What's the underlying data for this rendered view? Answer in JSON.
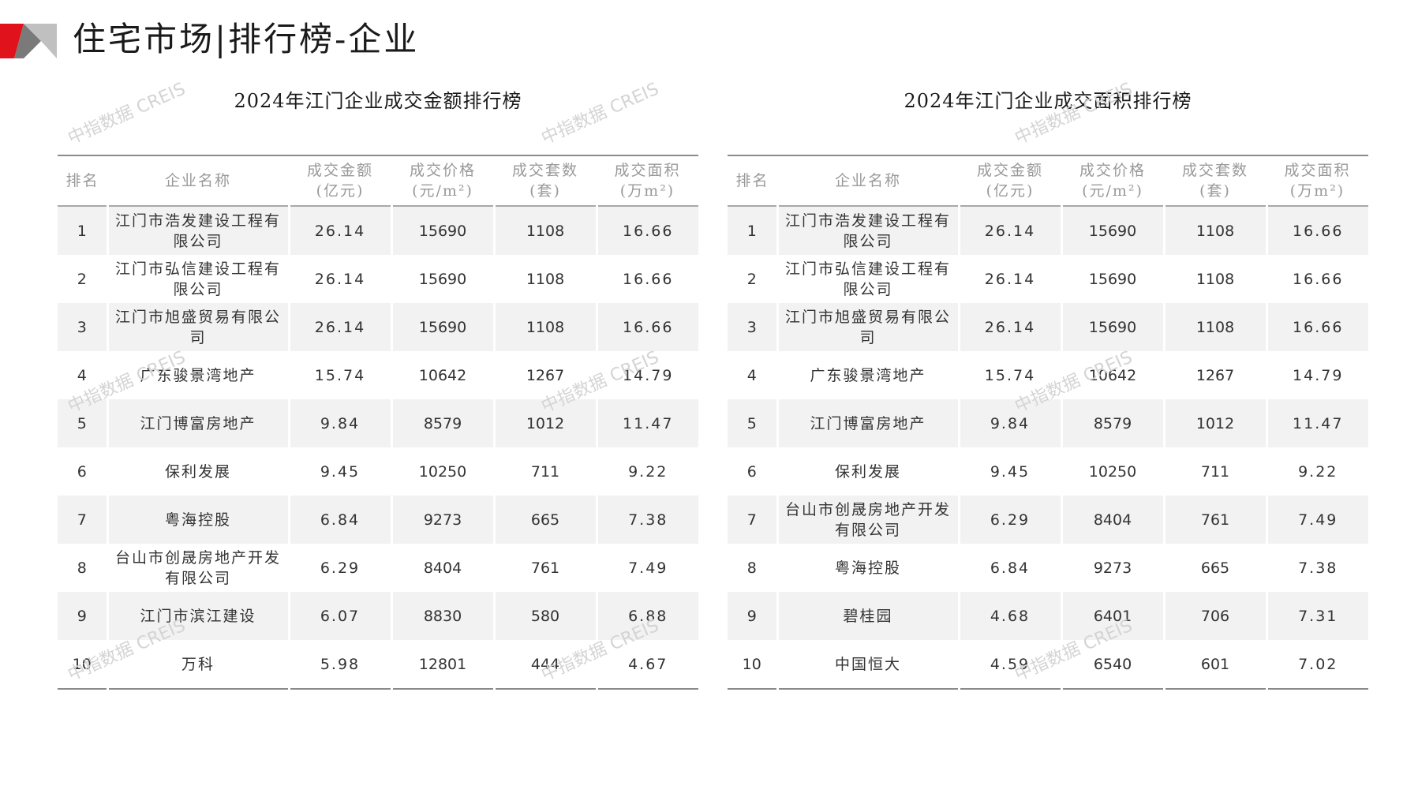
{
  "page": {
    "title": "住宅市场|排行榜-企业",
    "watermark": "中指数据 CREIS",
    "accent_color": "#c8161d",
    "logo_colors": [
      "#e0121b",
      "#7a7a7a",
      "#c0c0c0"
    ]
  },
  "tables": [
    {
      "title": "2024年江门企业成交金额排行榜",
      "highlight_column": "amount",
      "headers": {
        "rank": "排名",
        "company": "企业名称",
        "amount": [
          "成交金额",
          "(亿元)"
        ],
        "price": [
          "成交价格",
          "(元/m²)"
        ],
        "units": [
          "成交套数",
          "(套)"
        ],
        "area": [
          "成交面积",
          "(万m²)"
        ]
      },
      "rows": [
        {
          "rank": "1",
          "company": [
            "江门市浩发建设工程有",
            "限公司"
          ],
          "amount": "26.14",
          "price": "15690",
          "units": "1108",
          "area": "16.66"
        },
        {
          "rank": "2",
          "company": [
            "江门市弘信建设工程有",
            "限公司"
          ],
          "amount": "26.14",
          "price": "15690",
          "units": "1108",
          "area": "16.66"
        },
        {
          "rank": "3",
          "company": [
            "江门市旭盛贸易有限公",
            "司"
          ],
          "amount": "26.14",
          "price": "15690",
          "units": "1108",
          "area": "16.66"
        },
        {
          "rank": "4",
          "company": [
            "广东骏景湾地产"
          ],
          "amount": "15.74",
          "price": "10642",
          "units": "1267",
          "area": "14.79"
        },
        {
          "rank": "5",
          "company": [
            "江门博富房地产"
          ],
          "amount": "9.84",
          "price": "8579",
          "units": "1012",
          "area": "11.47"
        },
        {
          "rank": "6",
          "company": [
            "保利发展"
          ],
          "amount": "9.45",
          "price": "10250",
          "units": "711",
          "area": "9.22"
        },
        {
          "rank": "7",
          "company": [
            "粤海控股"
          ],
          "amount": "6.84",
          "price": "9273",
          "units": "665",
          "area": "7.38"
        },
        {
          "rank": "8",
          "company": [
            "台山市创晟房地产开发",
            "有限公司"
          ],
          "amount": "6.29",
          "price": "8404",
          "units": "761",
          "area": "7.49"
        },
        {
          "rank": "9",
          "company": [
            "江门市滨江建设"
          ],
          "amount": "6.07",
          "price": "8830",
          "units": "580",
          "area": "6.88"
        },
        {
          "rank": "10",
          "company": [
            "万科"
          ],
          "amount": "5.98",
          "price": "12801",
          "units": "444",
          "area": "4.67"
        }
      ]
    },
    {
      "title": "2024年江门企业成交面积排行榜",
      "highlight_column": "area",
      "headers": {
        "rank": "排名",
        "company": "企业名称",
        "amount": [
          "成交金额",
          "(亿元)"
        ],
        "price": [
          "成交价格",
          "(元/m²)"
        ],
        "units": [
          "成交套数",
          "(套)"
        ],
        "area": [
          "成交面积",
          "(万m²)"
        ]
      },
      "rows": [
        {
          "rank": "1",
          "company": [
            "江门市浩发建设工程有",
            "限公司"
          ],
          "amount": "26.14",
          "price": "15690",
          "units": "1108",
          "area": "16.66"
        },
        {
          "rank": "2",
          "company": [
            "江门市弘信建设工程有",
            "限公司"
          ],
          "amount": "26.14",
          "price": "15690",
          "units": "1108",
          "area": "16.66"
        },
        {
          "rank": "3",
          "company": [
            "江门市旭盛贸易有限公",
            "司"
          ],
          "amount": "26.14",
          "price": "15690",
          "units": "1108",
          "area": "16.66"
        },
        {
          "rank": "4",
          "company": [
            "广东骏景湾地产"
          ],
          "amount": "15.74",
          "price": "10642",
          "units": "1267",
          "area": "14.79"
        },
        {
          "rank": "5",
          "company": [
            "江门博富房地产"
          ],
          "amount": "9.84",
          "price": "8579",
          "units": "1012",
          "area": "11.47"
        },
        {
          "rank": "6",
          "company": [
            "保利发展"
          ],
          "amount": "9.45",
          "price": "10250",
          "units": "711",
          "area": "9.22"
        },
        {
          "rank": "7",
          "company": [
            "台山市创晟房地产开发",
            "有限公司"
          ],
          "amount": "6.29",
          "price": "8404",
          "units": "761",
          "area": "7.49"
        },
        {
          "rank": "8",
          "company": [
            "粤海控股"
          ],
          "amount": "6.84",
          "price": "9273",
          "units": "665",
          "area": "7.38"
        },
        {
          "rank": "9",
          "company": [
            "碧桂园"
          ],
          "amount": "4.68",
          "price": "6401",
          "units": "706",
          "area": "7.31"
        },
        {
          "rank": "10",
          "company": [
            "中国恒大"
          ],
          "amount": "4.59",
          "price": "6540",
          "units": "601",
          "area": "7.02"
        }
      ]
    }
  ]
}
